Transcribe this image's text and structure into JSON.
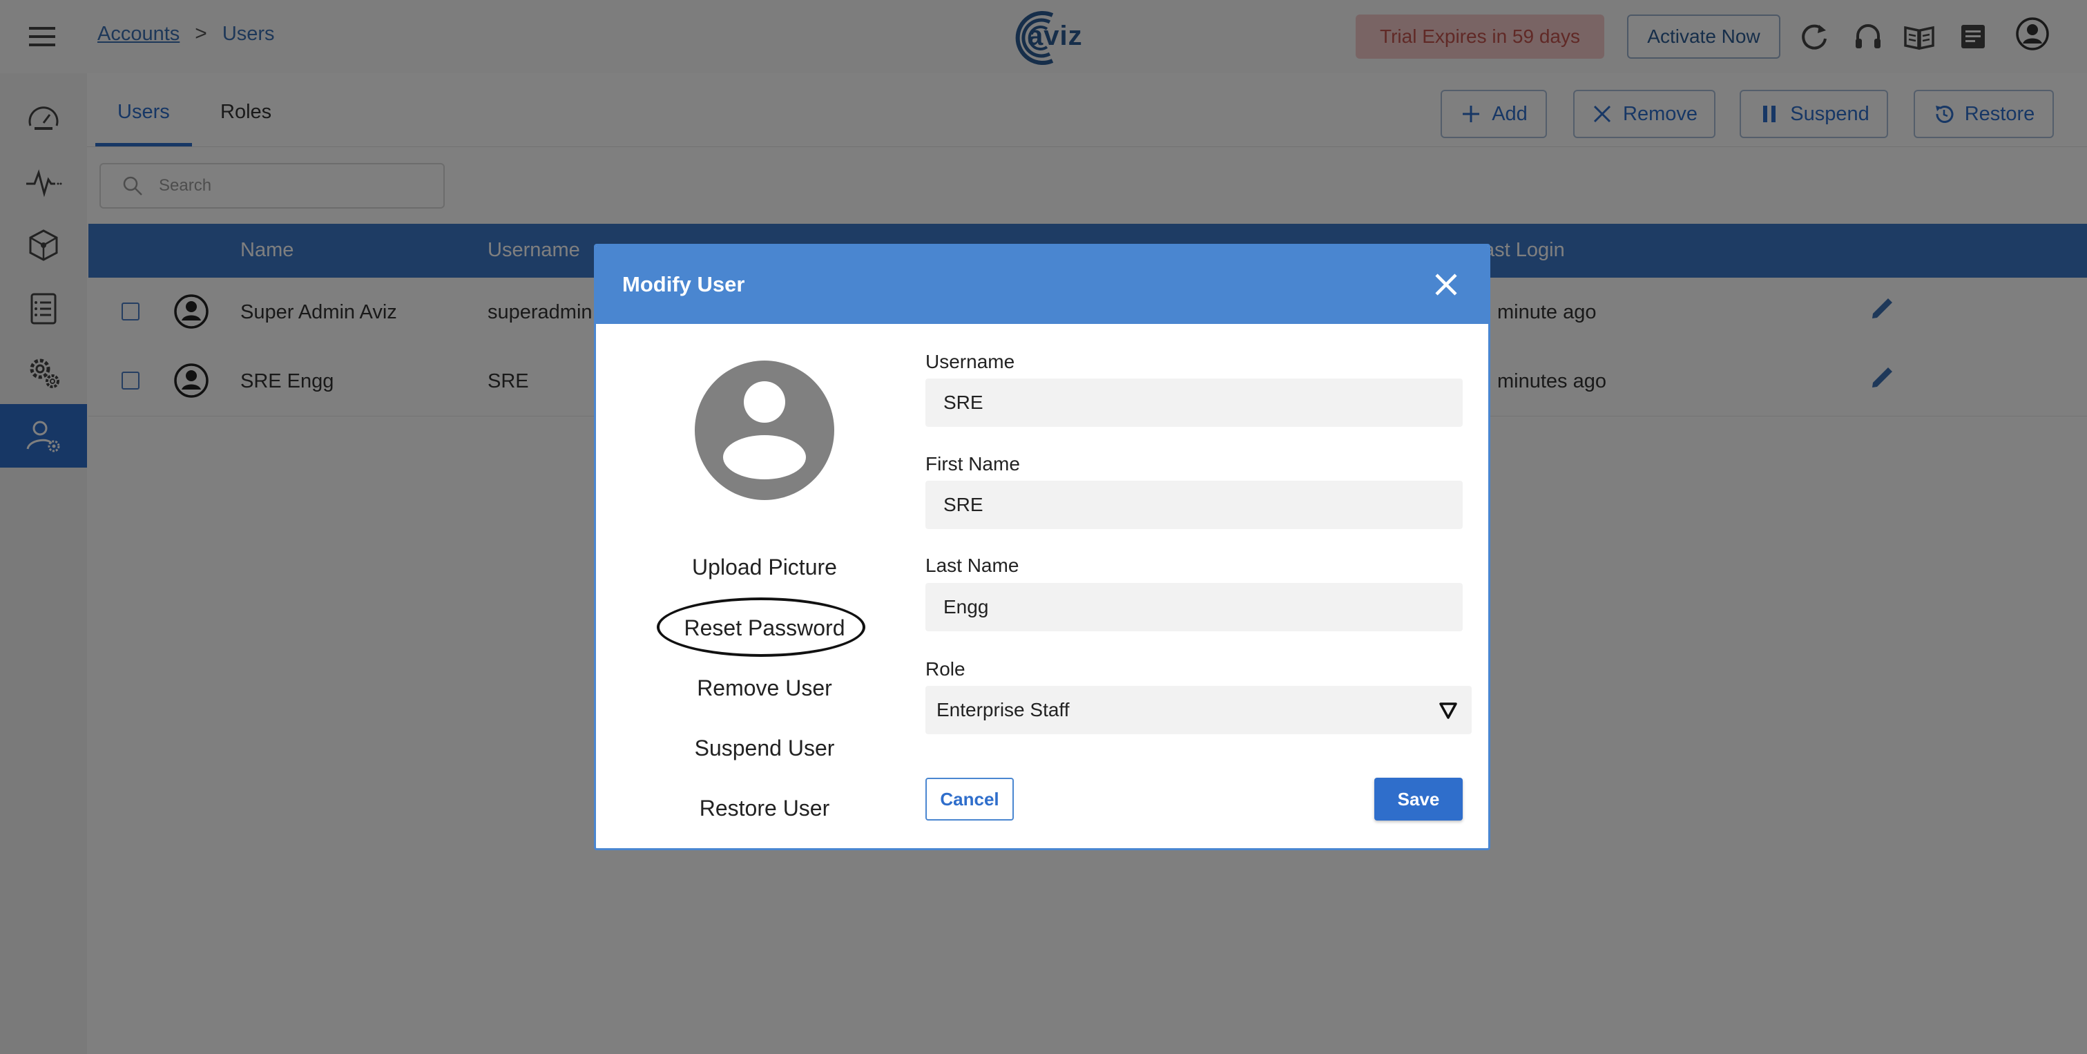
{
  "header": {
    "breadcrumb": {
      "parent": "Accounts",
      "separator": ">",
      "current": "Users"
    },
    "logo_text": "aviz",
    "trial_badge": "Trial Expires in 59 days",
    "activate_label": "Activate Now",
    "icons": [
      "refresh-icon",
      "headset-icon",
      "book-icon",
      "notes-icon",
      "account-icon"
    ]
  },
  "sidebar": {
    "items": [
      {
        "icon": "dashboard-gauge-icon",
        "active": false
      },
      {
        "icon": "pulse-icon",
        "active": false
      },
      {
        "icon": "network-cube-icon",
        "active": false
      },
      {
        "icon": "report-list-icon",
        "active": false
      },
      {
        "icon": "settings-gears-icon",
        "active": false
      },
      {
        "icon": "user-settings-icon",
        "active": true
      }
    ]
  },
  "tabs": {
    "users": "Users",
    "roles": "Roles"
  },
  "actions": {
    "add": "Add",
    "remove": "Remove",
    "suspend": "Suspend",
    "restore": "Restore"
  },
  "search": {
    "placeholder": "Search"
  },
  "table": {
    "columns": {
      "name": "Name",
      "username": "Username",
      "last_login": "ast Login"
    },
    "rows": [
      {
        "name": "Super Admin Aviz",
        "username": "superadmin",
        "last_login": "minute ago"
      },
      {
        "name": "SRE Engg",
        "username": "SRE",
        "last_login": "minutes ago"
      }
    ]
  },
  "modal": {
    "title": "Modify User",
    "links": {
      "upload": "Upload Picture",
      "reset": "Reset Password",
      "remove": "Remove User",
      "suspend": "Suspend User",
      "restore": "Restore User"
    },
    "fields": {
      "username_label": "Username",
      "username_value": "SRE",
      "first_name_label": "First Name",
      "first_name_value": "SRE",
      "last_name_label": "Last Name",
      "last_name_value": "Engg",
      "role_label": "Role",
      "role_value": "Enterprise Staff"
    },
    "cancel_label": "Cancel",
    "save_label": "Save"
  },
  "colors": {
    "primary": "#2f6ecb",
    "modal_header": "#4a86d0",
    "table_header": "#3d78c9",
    "trial_bg": "#f2c9c9",
    "trial_text": "#c1524d"
  }
}
